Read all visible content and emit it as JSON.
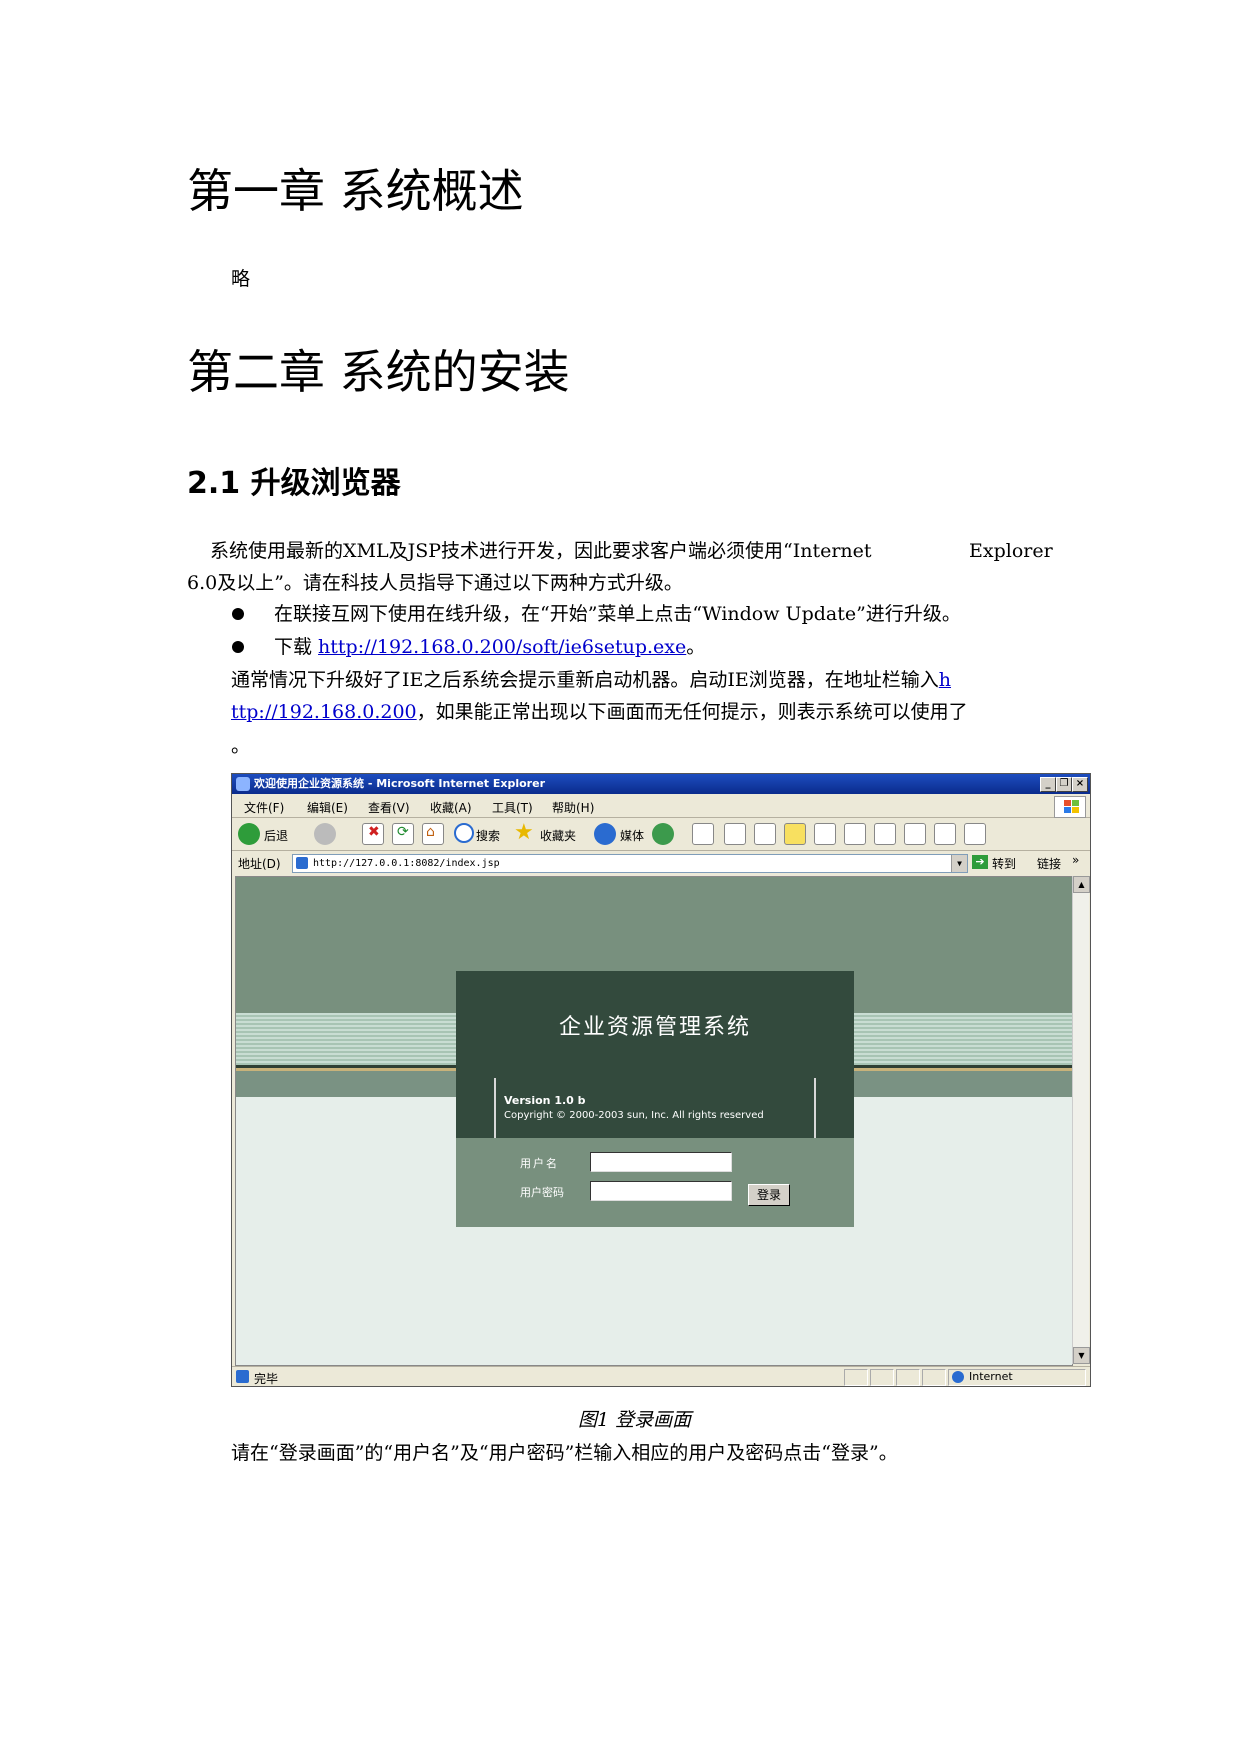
{
  "chapter1": {
    "title": "第一章 系统概述",
    "body": "略"
  },
  "chapter2": {
    "title": "第二章 系统的安装",
    "section_title": "2.1 升级浏览器",
    "intro_line1_a": "系统使用最新的XML及JSP技术进行开发，因此要求客户端必须使用“Internet",
    "intro_line1_b": "Explorer",
    "intro_line2": "6.0及以上”。请在科技人员指导下通过以下两种方式升级。",
    "bullet1": "在联接互网下使用在线升级，在“开始”菜单上点击“Window Update”进行升级。",
    "bullet2_prefix": "下载 ",
    "bullet2_link": "http://192.168.0.200/soft/ie6setup.exe",
    "bullet2_suffix": "。",
    "para_line1_text": "通常情况下升级好了IE之后系统会提示重新启动机器。启动IE浏览器，在地址栏输入",
    "para_line1_link": "h",
    "para_line2_link": "ttp://192.168.0.200",
    "para_line2_text": "，如果能正常出现以下画面而无任何提示，则表示系统可以使用了",
    "para_line3": "。",
    "caption": "图1 登录画面",
    "after_caption": "请在“登录画面”的“用户名”及“用户密码”栏输入相应的用户及密码点击“登录”。"
  },
  "screenshot": {
    "window_title": "欢迎使用企业资源系统 - Microsoft Internet Explorer",
    "menu": [
      "文件(F)",
      "编辑(E)",
      "查看(V)",
      "收藏(A)",
      "工具(T)",
      "帮助(H)"
    ],
    "toolbar": {
      "back": "后退",
      "search": "搜索",
      "favorites": "收藏夹",
      "media": "媒体"
    },
    "address_label": "地址(D)",
    "address_url": "http://127.0.0.1:8082/index.jsp",
    "go_label": "转到",
    "links_label": "链接",
    "status_text": "完毕",
    "zone_text": "Internet",
    "page": {
      "system_title": "企业资源管理系统",
      "version": "Version 1.0 b",
      "copyright": "Copyright © 2000-2003 sun, Inc. All rights reserved",
      "username_label": "用户名",
      "password_label": "用户密码",
      "login_button": "登录"
    }
  }
}
